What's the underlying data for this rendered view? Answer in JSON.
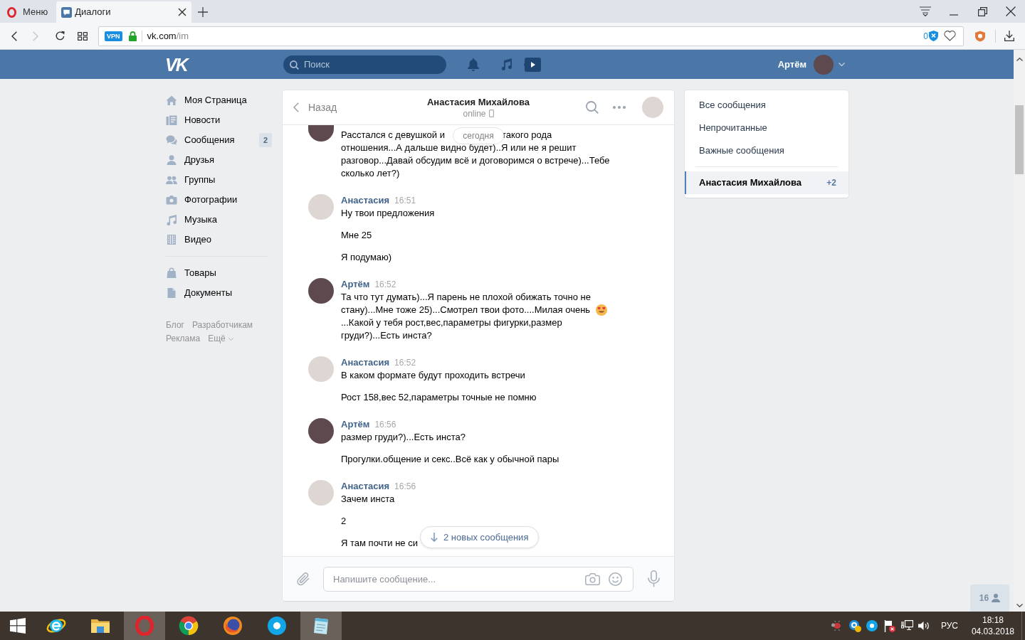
{
  "browser": {
    "menu_label": "Меню",
    "tabs": [
      {
        "title": "Диалоги",
        "selected": true
      }
    ],
    "forward_disabled": true,
    "vpn_badge": "VPN",
    "url_host": "vk.com",
    "url_path": "/im",
    "blocked_count": "0"
  },
  "header": {
    "logo": "VK",
    "search_placeholder": "Поиск",
    "user_name": "Артём"
  },
  "sidebar": {
    "groups": [
      [
        {
          "label": "Моя Страница"
        },
        {
          "label": "Новости"
        },
        {
          "label": "Сообщения",
          "count": "2"
        },
        {
          "label": "Друзья"
        },
        {
          "label": "Группы"
        },
        {
          "label": "Фотографии"
        },
        {
          "label": "Музыка"
        },
        {
          "label": "Видео"
        }
      ],
      [
        {
          "label": "Товары"
        },
        {
          "label": "Документы"
        }
      ]
    ],
    "footer_links": [
      "Блог",
      "Разработчикам",
      "Реклама",
      "Ещё"
    ]
  },
  "chat": {
    "back_label": "Назад",
    "title": "Анастасия Михайлова",
    "status": "online",
    "date_label": "сегодня",
    "groups": [
      {
        "outgoing": true,
        "first_line_parts": [
          "Расстался с девушкой и",
          "такого рода"
        ],
        "messages": [
          {
            "parts": [
              {
                "kind": "text",
                "text": "отношения...А дальше видно будет)..Я или не я решит разговор...Давай обсудим всё и договоримся о встрече)...Тебе сколько лет?)"
              }
            ]
          }
        ]
      },
      {
        "outgoing": false,
        "author": "Анастасия",
        "time": "16:51",
        "messages": [
          {
            "parts": [
              {
                "kind": "text",
                "text": "Ну твои предложения"
              }
            ]
          },
          {
            "parts": [
              {
                "kind": "text",
                "text": "Мне 25"
              }
            ]
          },
          {
            "parts": [
              {
                "kind": "text",
                "text": "Я подумаю)"
              }
            ]
          }
        ]
      },
      {
        "outgoing": true,
        "author": "Артём",
        "time": "16:52",
        "messages": [
          {
            "parts": [
              {
                "kind": "text",
                "text": "Та что тут думать)...Я парень не плохой обижать точно не стану)...Мне тоже 25)...Смотрел твои фото....Милая очень"
              },
              {
                "kind": "emoji"
              },
              {
                "kind": "text",
                "text": "...Какой у тебя рост,вес,параметры фигурки,размер груди?)...Есть инста?"
              }
            ]
          }
        ]
      },
      {
        "outgoing": false,
        "author": "Анастасия",
        "time": "16:52",
        "messages": [
          {
            "parts": [
              {
                "kind": "text",
                "text": "В каком формате будут проходить встречи"
              }
            ]
          },
          {
            "parts": [
              {
                "kind": "text",
                "text": "Рост 158,вес 52,параметры точные не помню"
              }
            ]
          }
        ]
      },
      {
        "outgoing": true,
        "author": "Артём",
        "time": "16:56",
        "messages": [
          {
            "parts": [
              {
                "kind": "text",
                "text": "размер груди?)...Есть инста?"
              }
            ]
          },
          {
            "parts": [
              {
                "kind": "text",
                "text": "Прогулки.общение и секс..Всё как у обычной пары"
              }
            ]
          }
        ]
      },
      {
        "outgoing": false,
        "author": "Анастасия",
        "time": "16:56",
        "messages": [
          {
            "parts": [
              {
                "kind": "text",
                "text": "Зачем инста"
              }
            ]
          },
          {
            "parts": [
              {
                "kind": "text",
                "text": "2"
              }
            ]
          },
          {
            "parts": [
              {
                "kind": "text",
                "text": "Я там почти не си"
              }
            ]
          }
        ]
      }
    ],
    "new_messages_button": "2 новых сообщения",
    "input_placeholder": "Напишите сообщение..."
  },
  "right_menu": {
    "filters": [
      {
        "label": "Все сообщения",
        "selected": false
      },
      {
        "label": "Непрочитанные",
        "selected": false
      },
      {
        "label": "Важные сообщения",
        "selected": false
      }
    ],
    "conversations": [
      {
        "name": "Анастасия Михайлова",
        "unread": "+2",
        "selected": true
      }
    ]
  },
  "online_friends": {
    "count": "16"
  },
  "taskbar": {
    "apps": [
      {
        "active": false
      },
      {
        "active": false
      },
      {
        "active": true
      },
      {
        "active": false
      },
      {
        "active": false
      },
      {
        "active": false
      },
      {
        "active": true
      }
    ],
    "language": "РУС",
    "time": "18:18",
    "date": "04.03.2018"
  }
}
